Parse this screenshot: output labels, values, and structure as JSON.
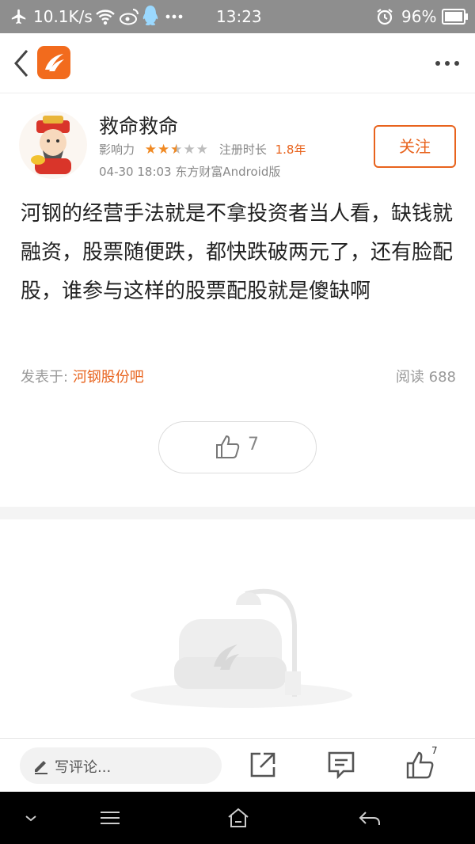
{
  "status_bar": {
    "speed": "10.1K/s",
    "time": "13:23",
    "battery": "96%",
    "icons": [
      "airplane-icon",
      "wifi-icon",
      "weibo-icon",
      "qq-icon",
      "more-dots-icon",
      "alarm-icon",
      "battery-icon"
    ]
  },
  "header": {
    "back_icon": "back-chevron-icon",
    "app_icon": "eastmoney-logo-icon",
    "more_icon": "more-horizontal-icon"
  },
  "author": {
    "name": "救命救命",
    "influence_label": "影响力",
    "influence_stars": 2.5,
    "influence_max": 5,
    "reg_label": "注册时长",
    "reg_value": "1.8年",
    "post_time": "04-30 18:03 东方财富Android版",
    "follow_label": "关注"
  },
  "post": {
    "content": "河钢的经营手法就是不拿投资者当人看，缺钱就融资，股票随便跌，都快跌破两元了，还有脸配股，谁参与这样的股票配股就是傻缺啊",
    "from_label": "发表于:",
    "from_bar": "河钢股份吧",
    "read_label": "阅读",
    "read_count": "688",
    "like_count": "7"
  },
  "bottom_bar": {
    "comment_placeholder": "写评论...",
    "like_badge": "7",
    "icons": [
      "pencil-icon",
      "share-icon",
      "comment-icon",
      "thumb-up-icon"
    ]
  },
  "nav_bar": {
    "icons": [
      "nav-collapse-icon",
      "nav-menu-icon",
      "nav-home-icon",
      "nav-back-icon"
    ]
  },
  "colors": {
    "accent": "#e8631d",
    "status_bar": "#8e8e8e",
    "star_on": "#f08a24",
    "star_off": "#bdbdbd"
  }
}
